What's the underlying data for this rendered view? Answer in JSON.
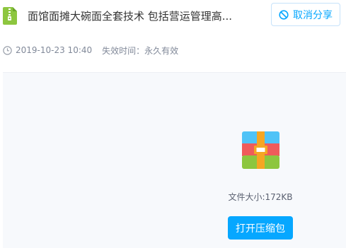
{
  "header": {
    "title": "面馆面摊大碗面全套技术 包括营运管理高...",
    "file_icon": "zip-file-icon",
    "cancel_share_label": "取消分享",
    "cancel_icon": "ban-icon"
  },
  "meta": {
    "clock_icon": "clock-icon",
    "date": "2019-10-23 10:40",
    "expiry": "失效时间：永久有效"
  },
  "preview": {
    "archive_icon": "archive-icon",
    "size_label": "文件大小:172KB",
    "open_button_label": "打开压缩包"
  },
  "colors": {
    "accent": "#06a7ff",
    "icon_green": "#8dc63f",
    "icon_red": "#ef5b5b",
    "icon_blue": "#4fc3f7",
    "icon_orange": "#f5a623"
  }
}
